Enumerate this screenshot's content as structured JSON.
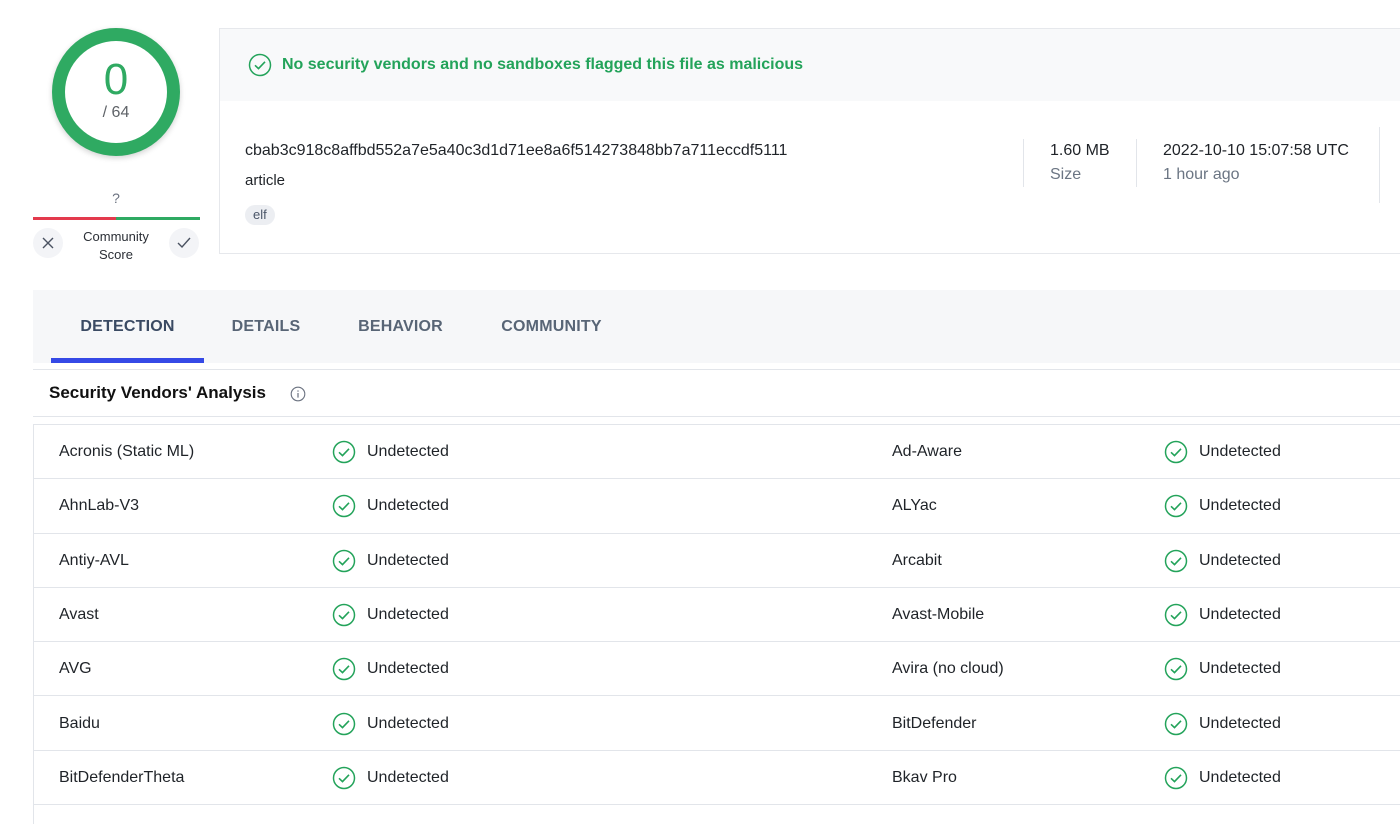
{
  "score": {
    "detections": "0",
    "total": "/ 64"
  },
  "community": {
    "unknown_mark": "?",
    "label_line1": "Community",
    "label_line2": "Score"
  },
  "banner": {
    "message": "No security vendors and no sandboxes flagged this file as malicious"
  },
  "file": {
    "hash": "cbab3c918c8affbd552a7e5a40c3d1d71ee8a6f514273848bb7a711eccdf5111",
    "name": "article",
    "tag": "elf",
    "size_value": "1.60 MB",
    "size_label": "Size",
    "date_value": "2022-10-10 15:07:58 UTC",
    "date_relative": "1 hour ago"
  },
  "tabs": [
    {
      "label": "DETECTION",
      "active": true
    },
    {
      "label": "DETAILS"
    },
    {
      "label": "BEHAVIOR"
    },
    {
      "label": "COMMUNITY"
    }
  ],
  "section": {
    "title": "Security Vendors' Analysis"
  },
  "vendors": [
    {
      "left": {
        "name": "Acronis (Static ML)",
        "result": "Undetected"
      },
      "right": {
        "name": "Ad-Aware",
        "result": "Undetected"
      }
    },
    {
      "left": {
        "name": "AhnLab-V3",
        "result": "Undetected"
      },
      "right": {
        "name": "ALYac",
        "result": "Undetected"
      }
    },
    {
      "left": {
        "name": "Antiy-AVL",
        "result": "Undetected"
      },
      "right": {
        "name": "Arcabit",
        "result": "Undetected"
      }
    },
    {
      "left": {
        "name": "Avast",
        "result": "Undetected"
      },
      "right": {
        "name": "Avast-Mobile",
        "result": "Undetected"
      }
    },
    {
      "left": {
        "name": "AVG",
        "result": "Undetected"
      },
      "right": {
        "name": "Avira (no cloud)",
        "result": "Undetected"
      }
    },
    {
      "left": {
        "name": "Baidu",
        "result": "Undetected"
      },
      "right": {
        "name": "BitDefender",
        "result": "Undetected"
      }
    },
    {
      "left": {
        "name": "BitDefenderTheta",
        "result": "Undetected"
      },
      "right": {
        "name": "Bkav Pro",
        "result": "Undetected"
      }
    }
  ],
  "colors": {
    "clean_green": "#2faa62",
    "active_tab": "#3549e6",
    "bad_red": "#e33a4d"
  }
}
